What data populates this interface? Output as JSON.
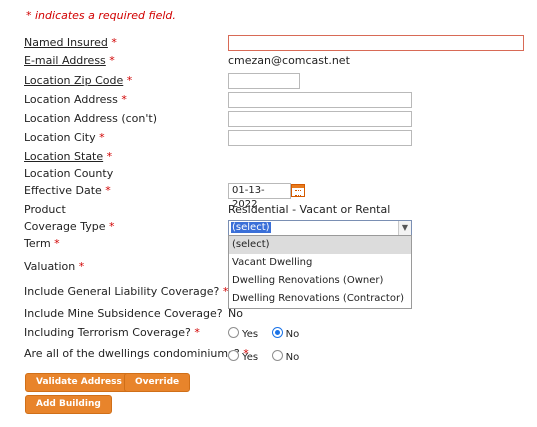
{
  "required_note": "* indicates a required field.",
  "fields": {
    "named_insured": {
      "label": "Named Insured",
      "required": "*"
    },
    "email": {
      "label": "E-mail Address",
      "required": "*",
      "value": "cmezan@comcast.net"
    },
    "zip": {
      "label": "Location Zip Code",
      "required": "*"
    },
    "address": {
      "label": "Location Address",
      "required": "*"
    },
    "address_cont": {
      "label": "Location Address (con't)"
    },
    "city": {
      "label": "Location City",
      "required": "*"
    },
    "state": {
      "label": "Location State",
      "required": "*"
    },
    "county": {
      "label": "Location County"
    },
    "effective_date": {
      "label": "Effective Date",
      "required": "*",
      "value": "01-13-2022"
    },
    "product": {
      "label": "Product",
      "value": "Residential - Vacant or Rental"
    },
    "coverage_type": {
      "label": "Coverage Type",
      "required": "*",
      "selected": "(select)",
      "options": [
        "(select)",
        "Vacant Dwelling",
        "Dwelling Renovations (Owner)",
        "Dwelling Renovations (Contractor)"
      ]
    },
    "term": {
      "label": "Term",
      "required": "*"
    },
    "valuation": {
      "label": "Valuation",
      "required": "*"
    },
    "general_liability": {
      "label": "Include General Liability Coverage?",
      "required": "*"
    },
    "mine_subsidence": {
      "label": "Include Mine Subsidence Coverage?",
      "value": "No"
    },
    "terrorism": {
      "label": "Including Terrorism Coverage?",
      "required": "*",
      "yes": "Yes",
      "no": "No"
    },
    "condominiums": {
      "label": "Are all of the dwellings condominiums?",
      "required": "*",
      "yes": "Yes",
      "no": "No"
    }
  },
  "buttons": {
    "validate": "Validate Address",
    "override": "Override",
    "add_building": "Add Building"
  },
  "colors": {
    "required_asterisk": "#d10000",
    "button_orange": "#e8842b",
    "selection_blue": "#3a6fd8"
  }
}
